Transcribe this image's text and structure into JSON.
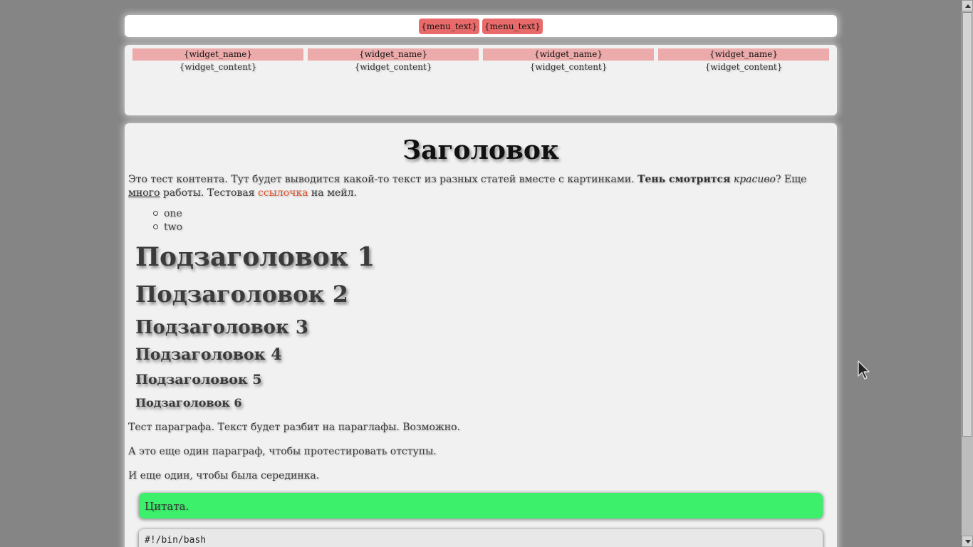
{
  "menu": {
    "items": [
      {
        "label": "{menu_text}"
      },
      {
        "label": "{menu_text}"
      }
    ]
  },
  "widgets": [
    {
      "name": "{widget_name}",
      "content": "{widget_content}"
    },
    {
      "name": "{widget_name}",
      "content": "{widget_content}"
    },
    {
      "name": "{widget_name}",
      "content": "{widget_content}"
    },
    {
      "name": "{widget_name}",
      "content": "{widget_content}"
    }
  ],
  "content": {
    "title": "Заголовок",
    "intro": {
      "text1": "Это тест контента. Тут будет выводится какой-то текст из разных статей вместе с картинками. ",
      "bold": "Тень смотрится",
      "text2": " ",
      "italic": "красиво",
      "text3": "? Еще ",
      "underline": "много",
      "text4": " работы. Тестовая ",
      "link": "ссылочка",
      "text5": " на мейл."
    },
    "list": [
      "one",
      "two"
    ],
    "subheadings": [
      "Подзаголовок 1",
      "Подзаголовок 2",
      "Подзаголовок 3",
      "Подзаголовок 4",
      "Подзаголовок 5",
      "Подзаголовок 6"
    ],
    "paragraphs": [
      "Тест параграфа. Текст будет разбит на параглафы. Возможно.",
      "А это еще один параграф, чтобы протестировать отступы.",
      "И еще один, чтобы была серединка."
    ],
    "quote": "Цитата.",
    "code": "#!/bin/bash"
  },
  "colors": {
    "background": "#858585",
    "menu_item": "#e86a6a",
    "widget_title": "#ecaaaa",
    "link": "#e05530",
    "quote": "#3df06c"
  },
  "icons": {
    "cursor": "arrow-cursor-icon",
    "scroll_up": "arrow-up-icon",
    "scroll_down": "arrow-down-icon"
  }
}
